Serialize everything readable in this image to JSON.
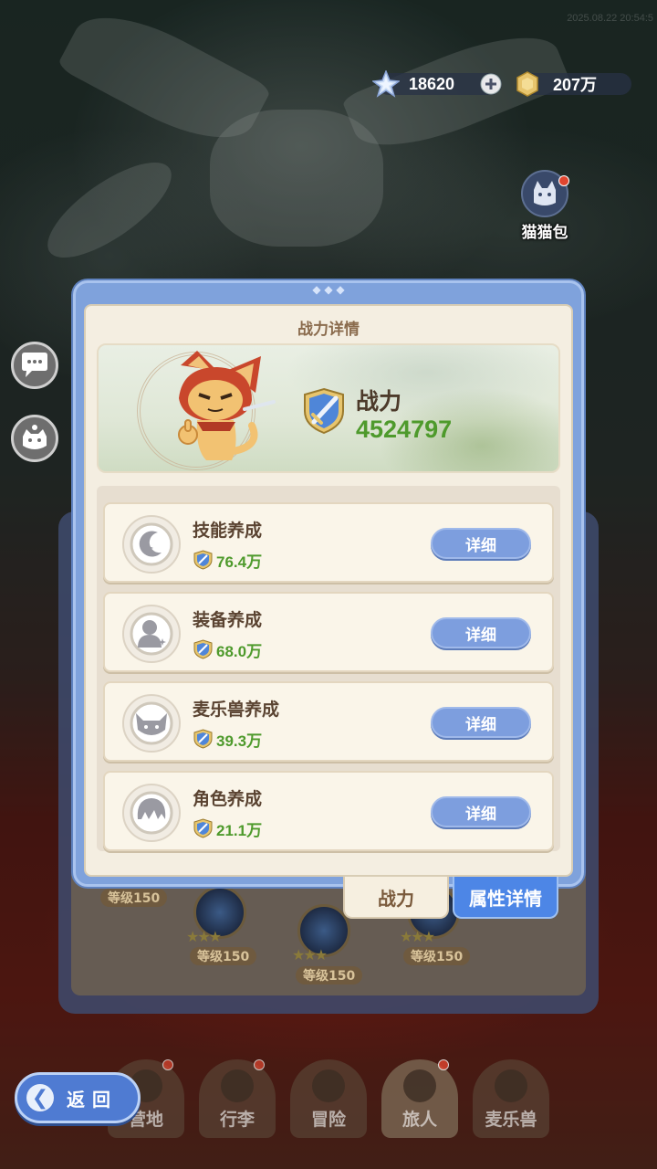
{
  "top_bar": {
    "timestamp": "2025.08.22 20:54:5",
    "gems": "18620",
    "coins": "207万",
    "gem_icon": "star-crystal-icon",
    "coin_icon": "gold-coin-icon",
    "add_icon": "plus-icon"
  },
  "side": {
    "cat_bag_label": "猫猫包"
  },
  "dialog": {
    "title": "战力详情",
    "power_label": "战力",
    "power_value": "4524797",
    "items": [
      {
        "name": "技能养成",
        "value": "76.4万",
        "button": "详细",
        "icon": "skill-moon-icon"
      },
      {
        "name": "装备养成",
        "value": "68.0万",
        "button": "详细",
        "icon": "equipment-figure-icon"
      },
      {
        "name": "麦乐兽养成",
        "value": "39.3万",
        "button": "详细",
        "icon": "fox-pet-icon"
      },
      {
        "name": "角色养成",
        "value": "21.1万",
        "button": "详细",
        "icon": "character-hair-icon"
      }
    ]
  },
  "tabs": {
    "power": "战力",
    "attributes": "属性详情"
  },
  "underlying": {
    "level_labels": [
      "等级150",
      "等级150",
      "等级150",
      "等级150"
    ]
  },
  "bottom_nav": {
    "items": [
      "营地",
      "行李",
      "冒险",
      "旅人",
      "麦乐兽"
    ],
    "active": "旅人"
  },
  "back_button": "返回",
  "colors": {
    "dialog_frame": "#7fa2dc",
    "power_green": "#4e9a2c",
    "detail_button": "#7d9ede",
    "tab_active_blue": "#4d86e6"
  }
}
